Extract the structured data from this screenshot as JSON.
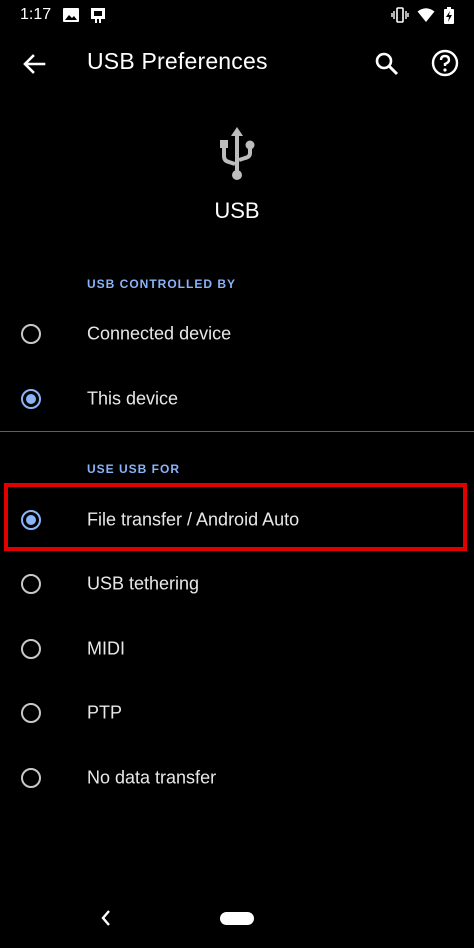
{
  "status_bar": {
    "time": "1:17"
  },
  "app_bar": {
    "title": "USB Preferences"
  },
  "hero": {
    "label": "USB"
  },
  "usb_controlled_by": {
    "header": "USB CONTROLLED BY",
    "options": [
      {
        "label": "Connected device",
        "selected": false
      },
      {
        "label": "This device",
        "selected": true
      }
    ]
  },
  "use_usb_for": {
    "header": "USE USB FOR",
    "options": [
      {
        "label": "File transfer / Android Auto",
        "selected": true
      },
      {
        "label": "USB tethering",
        "selected": false
      },
      {
        "label": "MIDI",
        "selected": false
      },
      {
        "label": "PTP",
        "selected": false
      },
      {
        "label": "No data transfer",
        "selected": false
      }
    ]
  },
  "colors": {
    "accent": "#8ab4f8",
    "highlight": "#e00000",
    "background": "#000000"
  }
}
